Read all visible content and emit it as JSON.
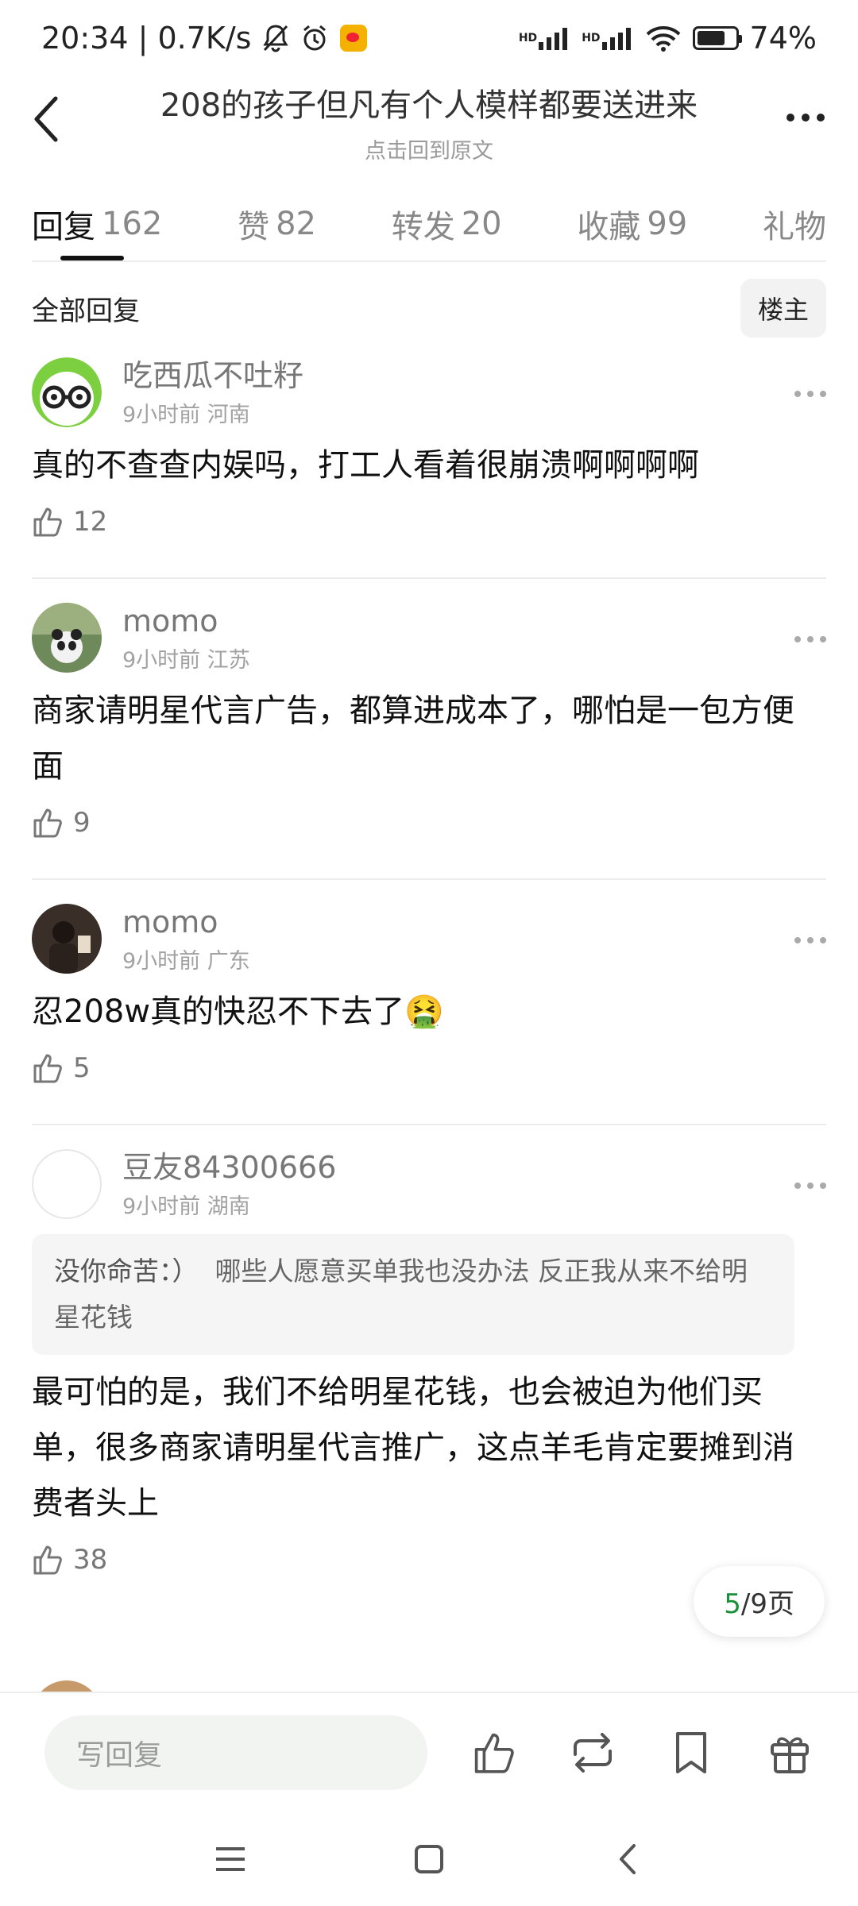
{
  "status_bar": {
    "time_speed": "20:34 | 0.7K/s",
    "hd1": "HD",
    "hd2": "HD",
    "battery_text": "74%",
    "battery_level": 0.74
  },
  "header": {
    "title": "208的孩子但凡有个人模样都要送进来",
    "subtitle": "点击回到原文"
  },
  "tabs": [
    {
      "label": "回复",
      "count": "162",
      "active": true
    },
    {
      "label": "赞",
      "count": "82"
    },
    {
      "label": "转发",
      "count": "20"
    },
    {
      "label": "收藏",
      "count": "99"
    },
    {
      "label": "礼物",
      "count": ""
    }
  ],
  "filter": {
    "label": "全部回复",
    "owner_button": "楼主"
  },
  "comments": [
    {
      "name": "吃西瓜不吐籽",
      "time": "9小时前",
      "location": "河南",
      "text": "真的不查查内娱吗，打工人看着很崩溃啊啊啊啊",
      "likes": "12"
    },
    {
      "name": "momo",
      "time": "9小时前",
      "location": "江苏",
      "text": "商家请明星代言广告，都算进成本了，哪怕是一包方便面",
      "likes": "9"
    },
    {
      "name": "momo",
      "time": "9小时前",
      "location": "广东",
      "text": "忍208w真的快忍不下去了🤮",
      "likes": "5"
    },
    {
      "name": "豆友84300666",
      "time": "9小时前",
      "location": "湖南",
      "quote_name": "没你命苦：）",
      "quote_text": "哪些人愿意买单我也没办法 反正我从来不给明星花钱",
      "text": "最可怕的是，我们不给明星花钱，也会被迫为他们买单，很多商家请明星代言推广，这点羊毛肯定要摊到消费者头上",
      "likes": "38"
    }
  ],
  "pagination": {
    "current": "5",
    "rest": "/9页"
  },
  "bottom_bar": {
    "reply_placeholder": "写回复"
  }
}
